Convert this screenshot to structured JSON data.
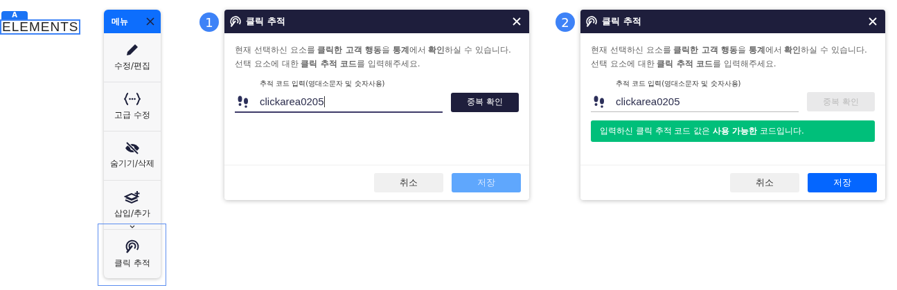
{
  "element_tag": {
    "badge": "A",
    "text": "ELEMENTS"
  },
  "menu": {
    "title": "메뉴",
    "items": [
      {
        "kind": "pencil",
        "label": "수정/편집",
        "selected": false
      },
      {
        "kind": "braces",
        "label": "고급 수정",
        "selected": false
      },
      {
        "kind": "hide",
        "label": "숨기기/삭제",
        "selected": false
      },
      {
        "kind": "layers",
        "label": "삽입/추가",
        "selected": false
      },
      {
        "kind": "click",
        "label": "클릭 추적",
        "selected": true
      }
    ]
  },
  "dialogs": [
    {
      "step": "1",
      "title": "클릭 추적",
      "description": [
        "현재 선택하신 요소를 **클릭한 고객 행동**을 **통계**에서 **확인**하실 수 있습니다.",
        "선택 요소에 대한 **클릭 추적 코드**를 입력해주세요."
      ],
      "field_label": "추적 코드 입력(영대소문자 및 숫자사용)",
      "value": "clickarea0205",
      "focused": true,
      "check_button": {
        "label": "중복 확인",
        "disabled": false
      },
      "cancel": "취소",
      "save": {
        "label": "저장",
        "disabled": true
      }
    },
    {
      "step": "2",
      "title": "클릭 추적",
      "description": [
        "현재 선택하신 요소를 **클릭한 고객 행동**을 **통계**에서 **확인**하실 수 있습니다.",
        "선택 요소에 대한 **클릭 추적 코드**를 입력해주세요."
      ],
      "field_label": "추적 코드 입력(영대소문자 및 숫자사용)",
      "value": "clickarea0205",
      "focused": false,
      "check_button": {
        "label": "중복 확인",
        "disabled": true
      },
      "message": "입력하신 클릭 추적 코드 값은 **사용 가능한** 코드입니다.",
      "cancel": "취소",
      "save": {
        "label": "저장",
        "disabled": false
      }
    }
  ]
}
